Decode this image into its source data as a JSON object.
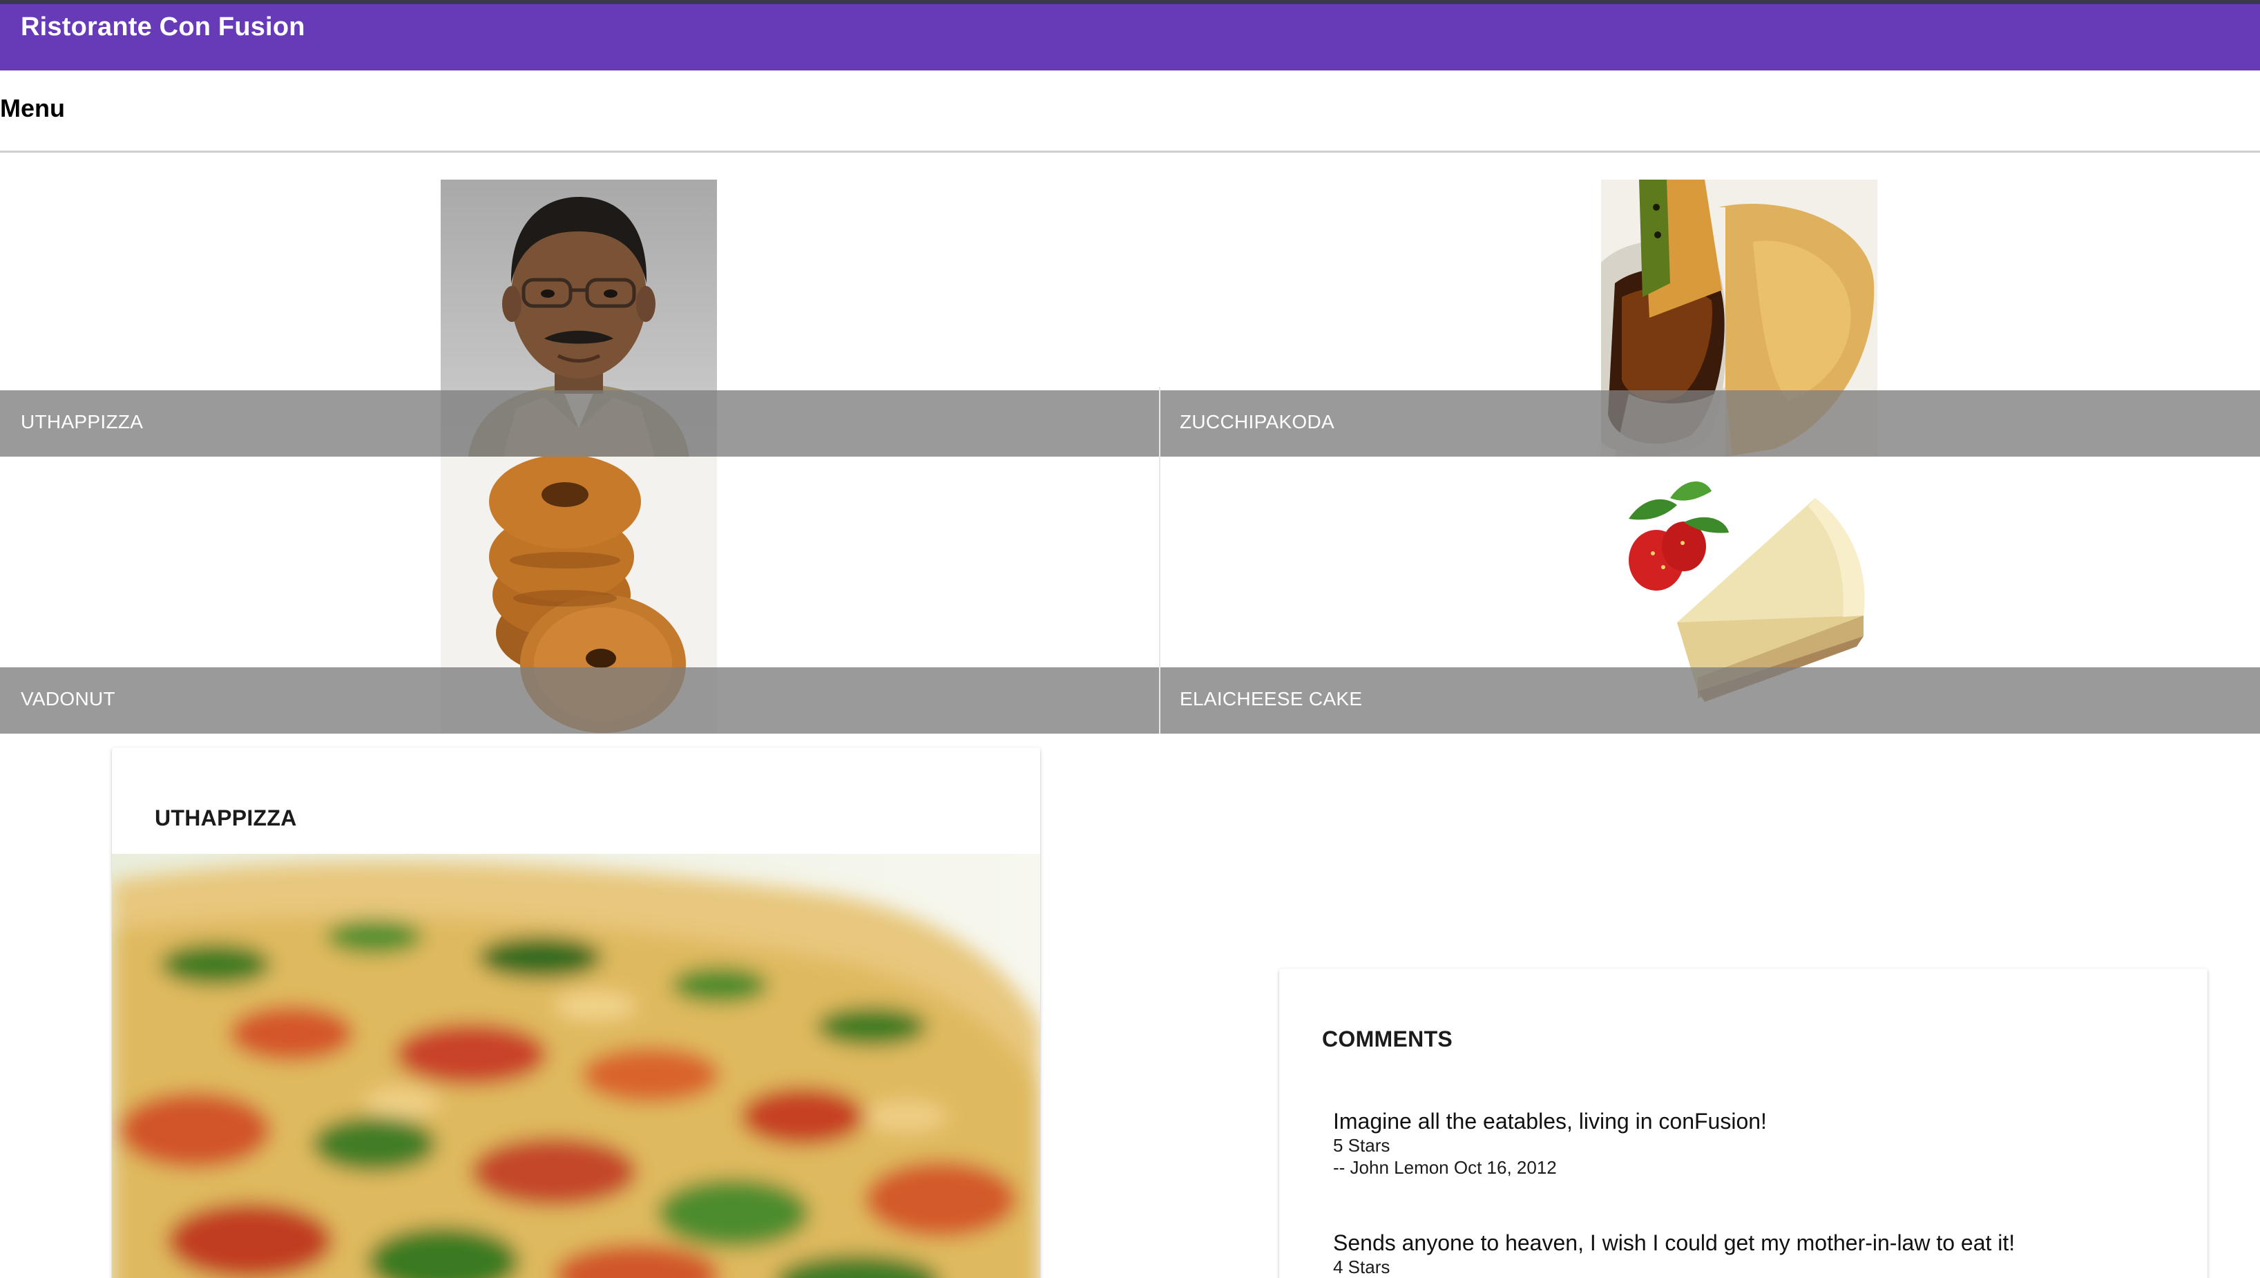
{
  "toolbar": {
    "title": "Ristorante Con Fusion",
    "color": "#673ab7"
  },
  "menu": {
    "heading": "Menu",
    "dishes": [
      {
        "label": "UTHAPPIZZA",
        "image": "portrait-photo"
      },
      {
        "label": "ZUCCHIPAKODA",
        "image": "pakoda-with-sauce-photo"
      },
      {
        "label": "VADONUT",
        "image": "vadonut-stack-photo"
      },
      {
        "label": "ELAICHEESE CAKE",
        "image": "cheesecake-slice-photo"
      }
    ]
  },
  "selected_dish": {
    "title": "UTHAPPIZZA",
    "image": "uthappizza-closeup-photo"
  },
  "comments": {
    "heading": "COMMENTS",
    "items": [
      {
        "text": "Imagine all the eatables, living in conFusion!",
        "rating": "5 Stars",
        "author_line": "-- John Lemon Oct 16, 2012"
      },
      {
        "text": "Sends anyone to heaven, I wish I could get my mother-in-law to eat it!",
        "rating": "4 Stars"
      }
    ]
  }
}
